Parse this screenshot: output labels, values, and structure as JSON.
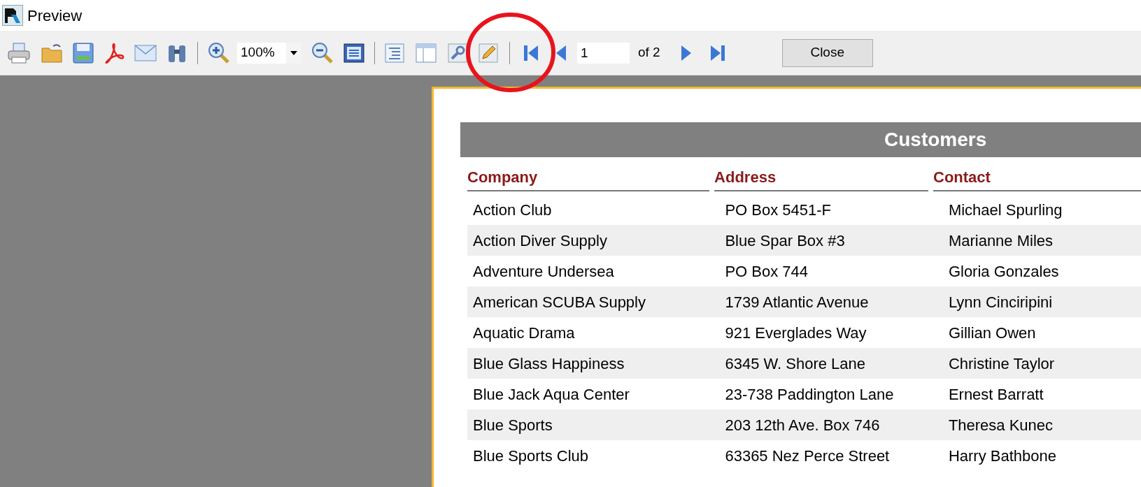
{
  "window": {
    "title": "Preview"
  },
  "toolbar": {
    "zoom": "100%",
    "page_input": "1",
    "page_count": "of 2",
    "close_button": "Close"
  },
  "report": {
    "title": "Customers",
    "columns": [
      "Company",
      "Address",
      "Contact"
    ],
    "rows": [
      [
        "Action Club",
        "PO Box 5451-F",
        "Michael Spurling"
      ],
      [
        "Action Diver Supply",
        "Blue Spar Box #3",
        "Marianne Miles"
      ],
      [
        "Adventure Undersea",
        "PO Box 744",
        "Gloria Gonzales"
      ],
      [
        "American SCUBA Supply",
        "1739 Atlantic Avenue",
        "Lynn Cinciripini"
      ],
      [
        "Aquatic Drama",
        "921 Everglades Way",
        "Gillian Owen"
      ],
      [
        "Blue Glass Happiness",
        "6345 W. Shore Lane",
        "Christine Taylor"
      ],
      [
        "Blue Jack Aqua Center",
        "23-738 Paddington Lane",
        "Ernest Barratt"
      ],
      [
        "Blue Sports",
        "203 12th Ave. Box 746",
        "Theresa Kunec"
      ],
      [
        "Blue Sports Club",
        "63365 Nez Perce Street",
        "Harry Bathbone"
      ]
    ]
  }
}
